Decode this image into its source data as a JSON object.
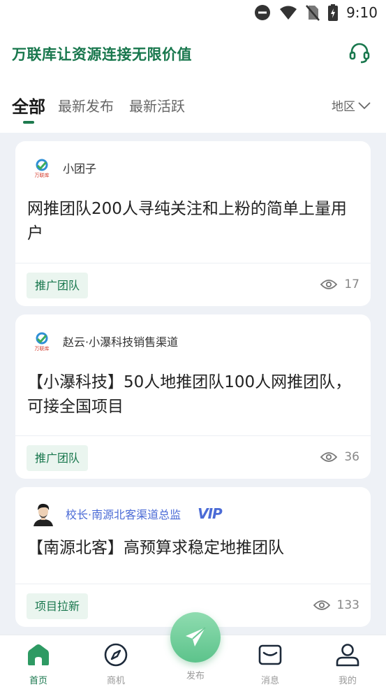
{
  "status_bar": {
    "time": "9:10"
  },
  "header": {
    "title": "万联库让资源连接无限价值"
  },
  "tabs": [
    {
      "label": "全部",
      "active": true
    },
    {
      "label": "最新发布",
      "active": false
    },
    {
      "label": "最新活跃",
      "active": false
    }
  ],
  "region_filter": {
    "label": "地区"
  },
  "posts": [
    {
      "author": "小团子",
      "avatar_text": "万联库",
      "vip": false,
      "content": "网推团队200人寻纯关注和上粉的简单上量用户",
      "tag": "推广团队",
      "views": "17"
    },
    {
      "author": "赵云·小瀑科技销售渠道",
      "avatar_text": "万联库",
      "vip": false,
      "content": "【小瀑科技】50人地推团队100人网推团队，可接全国项目",
      "tag": "推广团队",
      "views": "36"
    },
    {
      "author": "校长·南源北客渠道总监",
      "vip": true,
      "vip_label": "VIP",
      "content": "【南源北客】高预算求稳定地推团队",
      "tag": "项目拉新",
      "views": "133"
    }
  ],
  "bottom_nav": {
    "home": "首页",
    "business": "商机",
    "publish": "发布",
    "messages": "消息",
    "mine": "我的"
  },
  "colors": {
    "brand": "#18774d",
    "vip": "#4b6bd6",
    "tag_bg": "#eaf5ef"
  }
}
